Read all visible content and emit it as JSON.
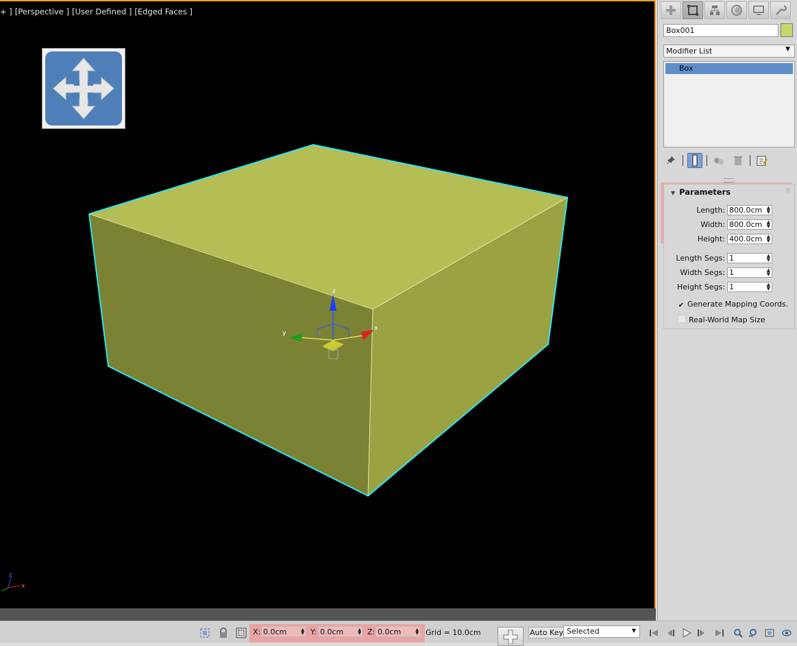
{
  "viewport": {
    "labels": [
      "+ ]",
      "[Perspective ]",
      "[User Defined ]",
      "[Edged Faces ]"
    ],
    "gizmo_axes": {
      "x": "x",
      "y": "y",
      "z": "z"
    },
    "corner_axes": {
      "x": "x",
      "z": "z"
    },
    "object_color": "#b5bd55",
    "edge_color": "#2fe3f0"
  },
  "command_panel": {
    "tabs": [
      "create-icon",
      "modify-icon",
      "hierarchy-icon",
      "motion-icon",
      "display-icon",
      "utilities-icon"
    ],
    "active_tab": 1,
    "object_name": "Box001",
    "object_color": "#c9d66a",
    "modifier_list": "Modifier List",
    "stack_items": [
      "Box"
    ],
    "rollout_title": "Parameters",
    "params": {
      "length_label": "Length:",
      "length_value": "800.0cm",
      "width_label": "Width:",
      "width_value": "800.0cm",
      "height_label": "Height:",
      "height_value": "400.0cm",
      "length_segs_label": "Length Segs:",
      "length_segs_value": "1",
      "width_segs_label": "Width Segs:",
      "width_segs_value": "1",
      "height_segs_label": "Height Segs:",
      "height_segs_value": "1",
      "gen_mapping_label": "Generate Mapping Coords.",
      "gen_mapping_checked": "✔",
      "real_world_label": "Real-World Map Size"
    }
  },
  "status_bar": {
    "x_label": "X:",
    "x_value": "0.0cm",
    "y_label": "Y:",
    "y_value": "0.0cm",
    "z_label": "Z:",
    "z_value": "0.0cm",
    "grid": "Grid = 10.0cm",
    "auto_key": "Auto Key",
    "selected": "Selected"
  }
}
